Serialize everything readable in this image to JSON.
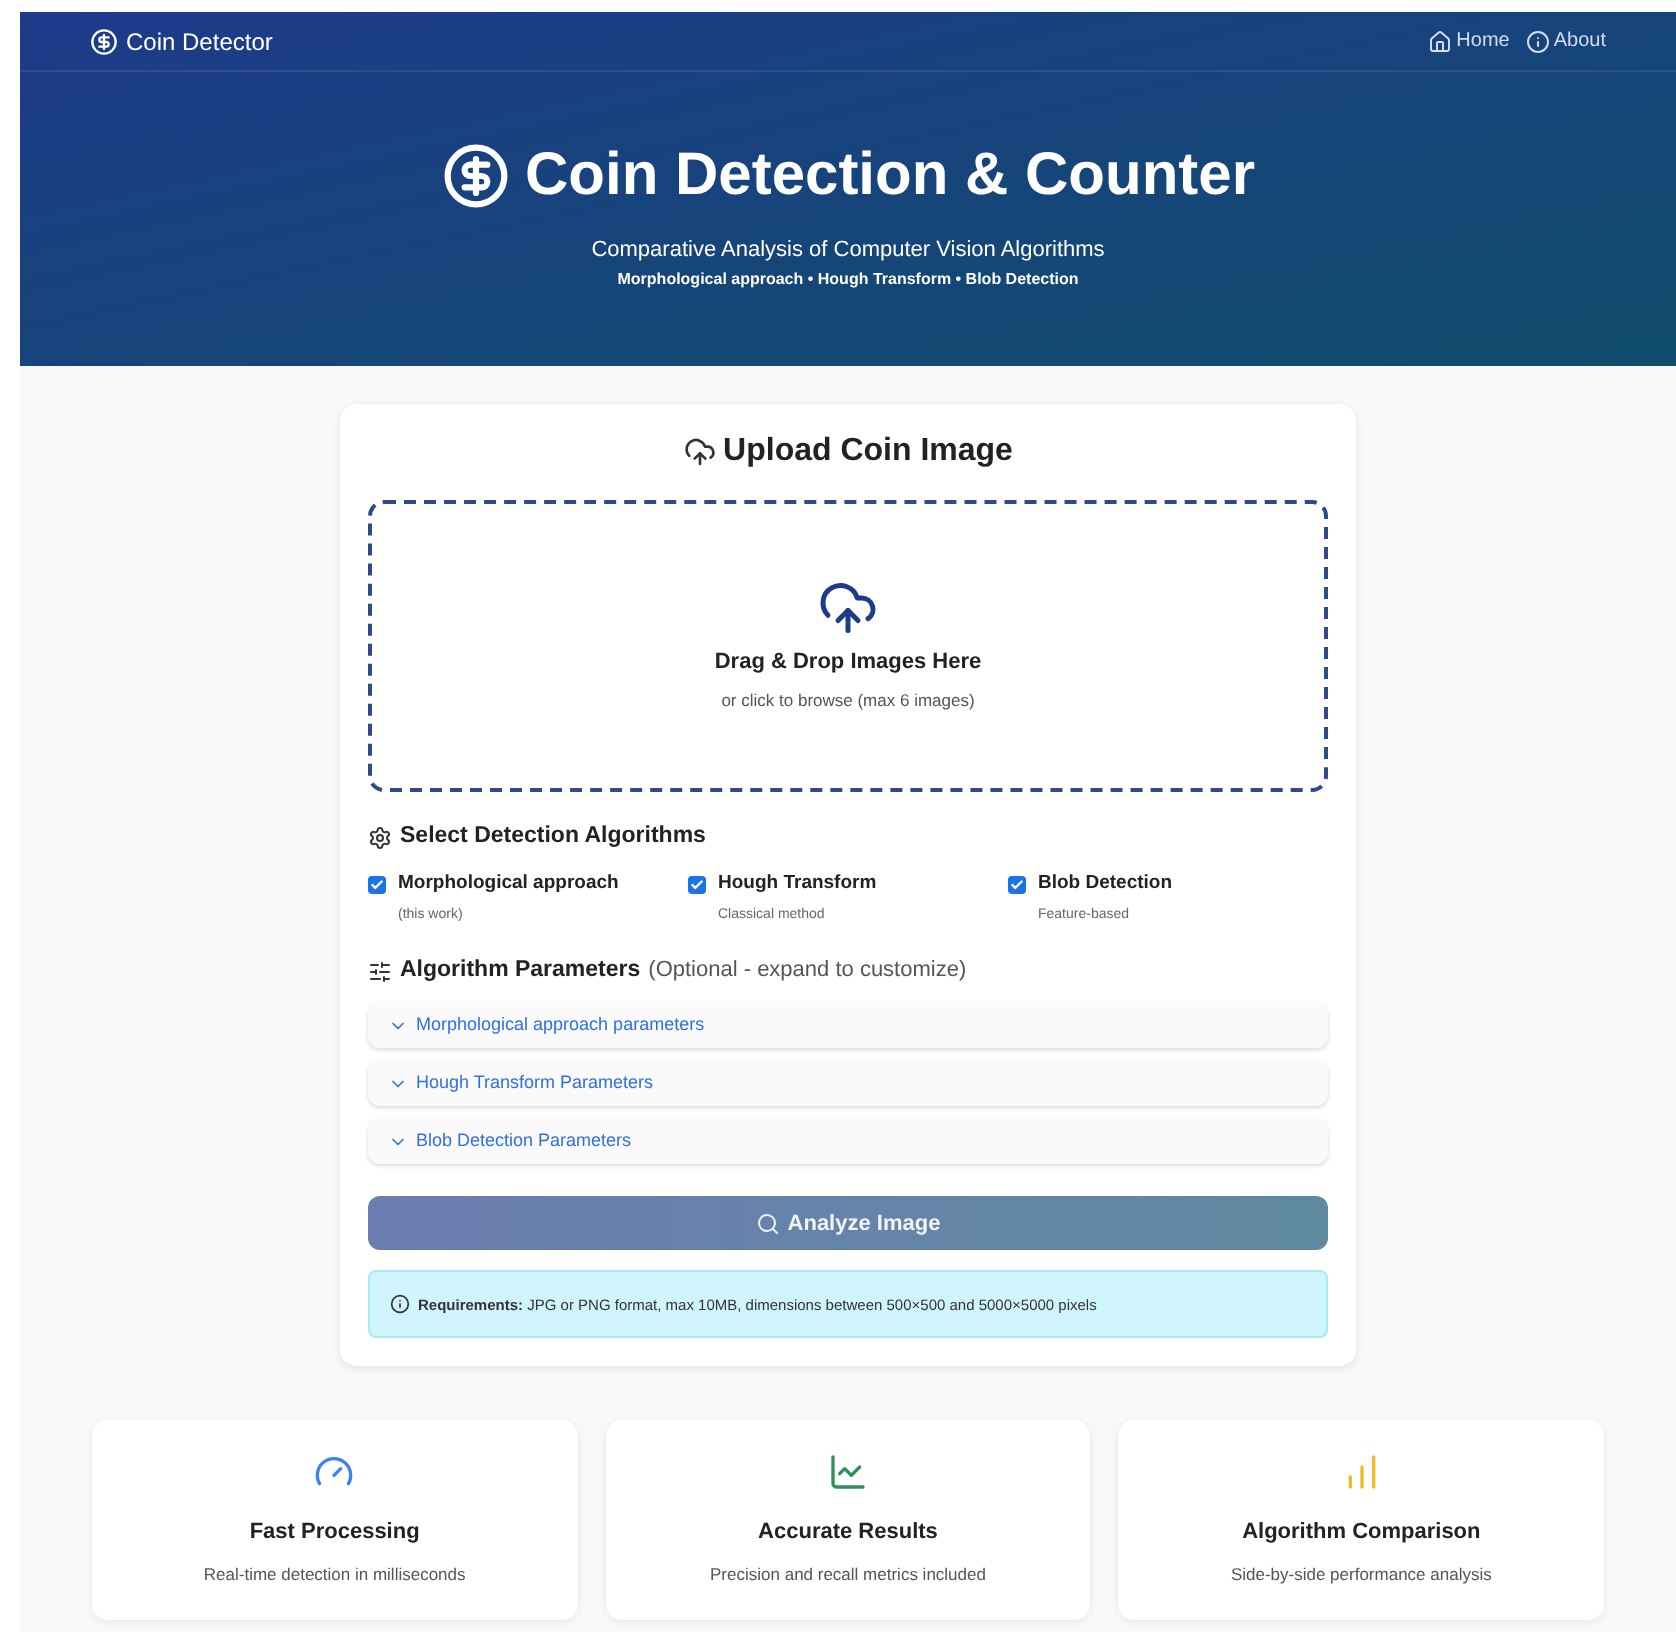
{
  "navbar": {
    "brand": "Coin Detector",
    "links": [
      {
        "label": "Home",
        "kind": "home"
      },
      {
        "label": "About",
        "kind": "info"
      }
    ]
  },
  "hero": {
    "title": "Coin Detection & Counter",
    "subtitle": "Comparative Analysis of Computer Vision Algorithms",
    "methods": "Morphological approach • Hough Transform • Blob Detection"
  },
  "upload": {
    "title": "Upload Coin Image",
    "dropzone_title": "Drag & Drop Images Here",
    "dropzone_hint": "or click to browse (max 6 images)"
  },
  "algorithms": {
    "title": "Select Detection Algorithms",
    "items": [
      {
        "label": "Morphological approach",
        "note": "(this work)",
        "checked": true
      },
      {
        "label": "Hough Transform",
        "note": "Classical method",
        "checked": true
      },
      {
        "label": "Blob Detection",
        "note": "Feature-based",
        "checked": true
      }
    ]
  },
  "parameters": {
    "title": "Algorithm Parameters",
    "hint": "(Optional - expand to customize)",
    "sections": [
      {
        "label": "Morphological approach parameters",
        "expanded": false
      },
      {
        "label": "Hough Transform Parameters",
        "expanded": false
      },
      {
        "label": "Blob Detection Parameters",
        "expanded": false
      }
    ]
  },
  "analyze_button": "Analyze Image",
  "requirements": "**Requirements:** JPG or PNG format, max 10MB, dimensions between 500×500 and 5000×5000 pixels",
  "features": [
    {
      "kind": "gauge",
      "title": "Fast Processing",
      "text": "Real-time detection in milliseconds"
    },
    {
      "kind": "chart-line",
      "title": "Accurate Results",
      "text": "Precision and recall metrics included"
    },
    {
      "kind": "chart-bar",
      "title": "Algorithm Comparison",
      "text": "Side-by-side performance analysis"
    }
  ]
}
